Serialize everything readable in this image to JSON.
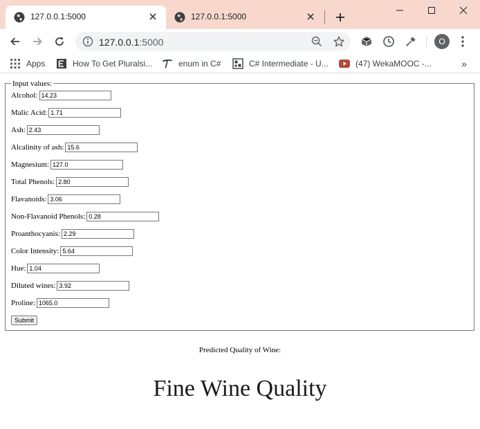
{
  "browser": {
    "tabs": [
      {
        "title": "127.0.0.1:5000"
      },
      {
        "title": "127.0.0.1:5000"
      }
    ],
    "address": {
      "host": "127.0.0.1",
      "port": ":5000"
    },
    "profile_initial": "O",
    "bookmarks": [
      {
        "label": "Apps",
        "icon": "apps-grid-icon"
      },
      {
        "label": "How To Get Pluralsi...",
        "icon": "bookmark-page-icon"
      },
      {
        "label": "enum in C#",
        "icon": "bookmark-t-icon"
      },
      {
        "label": "C# Intermediate - U...",
        "icon": "bookmark-site-icon"
      },
      {
        "label": "(47) WekaMOOC -...",
        "icon": "youtube-icon"
      }
    ],
    "more_bookmarks": "»"
  },
  "form": {
    "legend": "Input values:",
    "fields": [
      {
        "label": "Alcohol:",
        "value": "14.23"
      },
      {
        "label": "Malic Acid:",
        "value": "1.71"
      },
      {
        "label": "Ash:",
        "value": "2.43"
      },
      {
        "label": "Alcalinity of ash:",
        "value": "15.6"
      },
      {
        "label": "Magnesium:",
        "value": "127.0"
      },
      {
        "label": "Total Phenols:",
        "value": "2.80"
      },
      {
        "label": "Flavanoids:",
        "value": "3.06"
      },
      {
        "label": "Non-Flavanoid Phenols:",
        "value": "0.28"
      },
      {
        "label": "Proanthocyanis:",
        "value": "2.29"
      },
      {
        "label": "Color Intensity:",
        "value": "5.64"
      },
      {
        "label": "Hue:",
        "value": "1.04"
      },
      {
        "label": "Diluted wines:",
        "value": "3.92"
      },
      {
        "label": "Proline:",
        "value": "1065.0"
      }
    ],
    "submit_label": "Submit"
  },
  "result": {
    "label": "Predicted Quality of Wine:",
    "value": "Fine Wine Quality"
  },
  "colors": {
    "tabstrip": "#f8d8cd",
    "omnibox": "#f1f3f4",
    "page": "#ffffff"
  }
}
